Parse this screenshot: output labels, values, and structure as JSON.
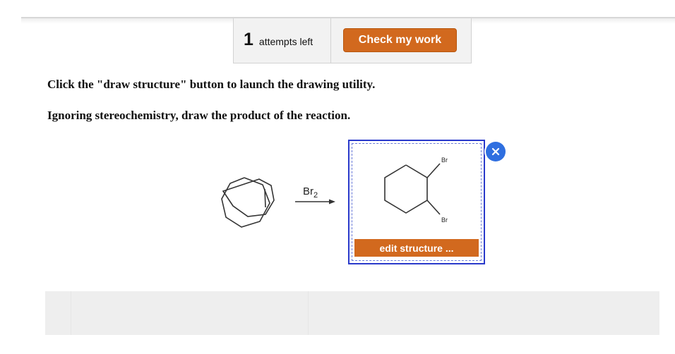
{
  "toolbar": {
    "attempts_count": "1",
    "attempts_label": "attempts left",
    "check_button": "Check my work"
  },
  "instructions": {
    "line1": "Click the \"draw structure\" button to launch the drawing utility.",
    "line2": "Ignoring stereochemistry, draw the product of the reaction."
  },
  "reaction": {
    "reagent": "Br",
    "reagent_subscript": "2"
  },
  "answer": {
    "substituent_top": "Br",
    "substituent_bottom": "Br",
    "edit_button": "edit structure ...",
    "close_icon": "close-icon"
  },
  "colors": {
    "accent_orange": "#d2691e",
    "answer_border": "#2a3acb",
    "close_blue": "#2f6fe0"
  }
}
